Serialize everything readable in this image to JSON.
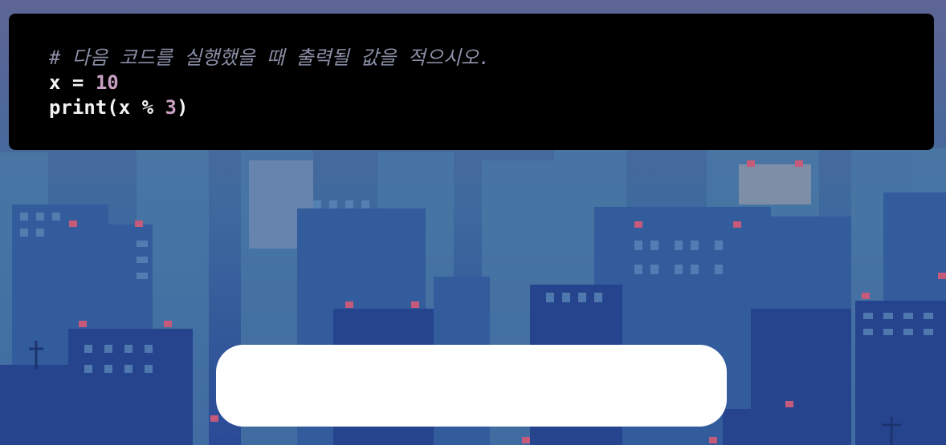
{
  "colors": {
    "sky_top": "#5e6594",
    "sky_bottom": "#2a4a96",
    "panel_bg": "#000000",
    "comment": "#8a8fa6",
    "code_text": "#f2f2f2",
    "number": "#c9a0c3",
    "input_bg": "#ffffff"
  },
  "question": {
    "comment": "# 다음 코드를 실행했을 때 출력될 값을 적으시오.",
    "line1": {
      "var": "x",
      "op": " = ",
      "value": "10"
    },
    "line2": {
      "func": "print(x % ",
      "value": "3",
      "close": ")"
    }
  },
  "answer_input": {
    "value": "",
    "placeholder": ""
  },
  "background": {
    "description_icon": "pixel-city-skyline"
  }
}
